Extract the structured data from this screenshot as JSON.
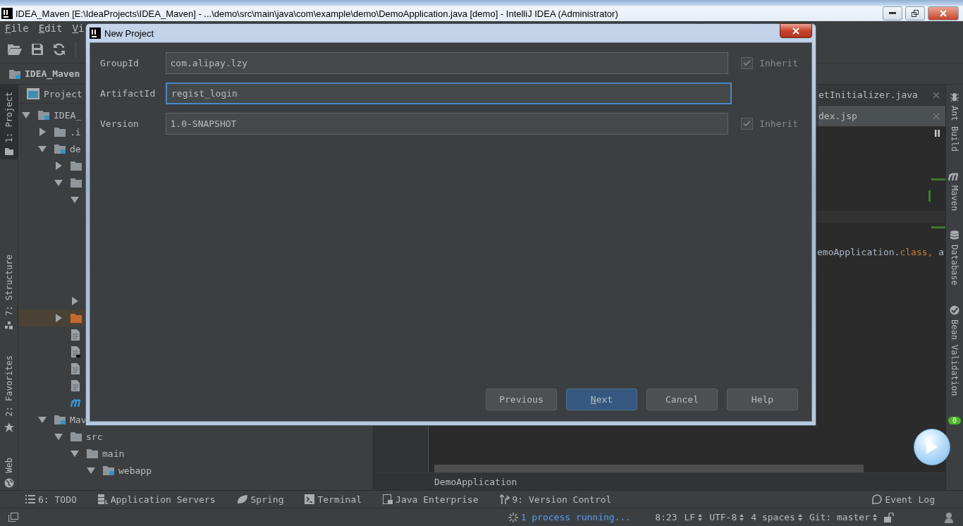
{
  "window": {
    "title": "IDEA_Maven [E:\\IdeaProjects\\IDEA_Maven] - ...\\demo\\src\\main\\java\\com\\example\\demo\\DemoApplication.java [demo] - IntelliJ IDEA (Administrator)"
  },
  "menu": [
    "File",
    "Edit",
    "Vi"
  ],
  "navigation": {
    "project": "IDEA_Maven"
  },
  "left_tool_windows": [
    {
      "label": "1: Project",
      "selected": true
    },
    {
      "label": "7: Structure",
      "selected": false
    },
    {
      "label": "2: Favorites",
      "selected": false
    },
    {
      "label": "Web",
      "selected": false
    }
  ],
  "project_panel": {
    "title": "Project",
    "tree": [
      {
        "label": "IDEA_",
        "kind": "module",
        "expanded": true,
        "selected": false,
        "children": [
          {
            "label": ".i",
            "kind": "folder",
            "expanded": false,
            "selected": false
          },
          {
            "label": "de",
            "kind": "module",
            "expanded": true,
            "selected": false,
            "children": [
              {
                "kind": "folder",
                "expanded": false,
                "selected": false
              },
              {
                "kind": "folder",
                "expanded": true,
                "selected": false,
                "children": [
                  {
                    "expanded": true,
                    "selected": false
                  },
                  {
                    "expanded": false,
                    "selected": false
                  }
                ]
              },
              {
                "kind": "excluded",
                "expanded": false,
                "selected": true
              },
              {
                "kind": "file",
                "selected": false
              },
              {
                "kind": "script",
                "selected": false
              },
              {
                "kind": "file",
                "selected": false
              },
              {
                "kind": "file",
                "selected": false
              },
              {
                "kind": "build",
                "selected": false
              }
            ]
          },
          {
            "label": "Mav",
            "kind": "module",
            "expanded": true,
            "selected": false,
            "children": [
              {
                "label": "src",
                "kind": "folder",
                "expanded": true,
                "selected": false,
                "children": [
                  {
                    "label": "main",
                    "kind": "folder",
                    "expanded": true,
                    "selected": false,
                    "children": [
                      {
                        "label": "webapp",
                        "kind": "web",
                        "expanded": true,
                        "selected": false
                      }
                    ]
                  }
                ]
              }
            ]
          }
        ]
      }
    ]
  },
  "editor": {
    "tabs": [
      {
        "label": "etInitializer.java",
        "selected": false
      },
      {
        "label": "dex.jsp",
        "selected": true
      }
    ],
    "code": [
      {
        "text": "emoApplication.",
        "kind": "plain"
      },
      {
        "text": "class, ",
        "kind": "keyword"
      },
      {
        "text": "a",
        "kind": "plain"
      }
    ],
    "breadcrumb": "DemoApplication"
  },
  "right_tool_windows": [
    {
      "label": "Ant Build"
    },
    {
      "label": "Maven"
    },
    {
      "label": "Database"
    },
    {
      "label": "Bean Validation"
    }
  ],
  "notifications_badge": "0",
  "bottom_tool_windows": [
    {
      "label": "6: TODO"
    },
    {
      "label": "Application Servers"
    },
    {
      "label": "Spring"
    },
    {
      "label": "Terminal"
    },
    {
      "label": "Java Enterprise"
    },
    {
      "label": "9: Version Control"
    },
    {
      "label": "Event Log"
    }
  ],
  "status_bar": {
    "process": "1 process running...",
    "position": "8:23",
    "line_separator": "LF",
    "encoding": "UTF-8",
    "indent": "4 spaces",
    "vcs": "Git: master"
  },
  "dialog": {
    "title": "New Project",
    "fields": [
      {
        "label": "GroupId",
        "value": "com.alipay.lzy",
        "focused": false,
        "inherit": {
          "label": "Inherit",
          "checked": true
        }
      },
      {
        "label": "ArtifactId",
        "value": "regist_login",
        "focused": true
      },
      {
        "label": "Version",
        "value": "1.0-SNAPSHOT",
        "focused": false,
        "inherit": {
          "label": "Inherit",
          "checked": true
        }
      }
    ],
    "buttons": [
      {
        "label": "Previous",
        "default": false
      },
      {
        "label": "Next",
        "default": true
      },
      {
        "label": "Cancel",
        "default": false
      },
      {
        "label": "Help",
        "default": false
      }
    ]
  }
}
